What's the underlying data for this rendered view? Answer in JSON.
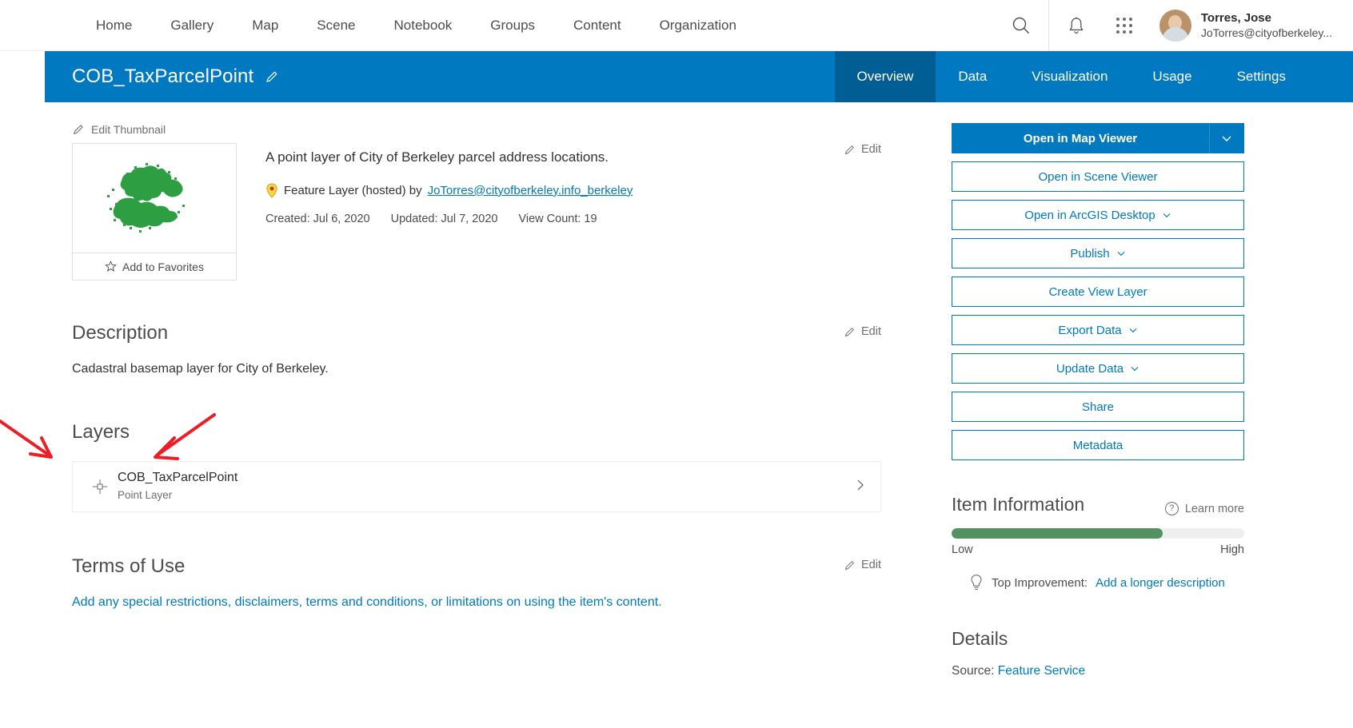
{
  "topnav": {
    "links": [
      {
        "label": "Home"
      },
      {
        "label": "Gallery"
      },
      {
        "label": "Map"
      },
      {
        "label": "Scene"
      },
      {
        "label": "Notebook"
      },
      {
        "label": "Groups"
      },
      {
        "label": "Content"
      },
      {
        "label": "Organization"
      }
    ],
    "search_icon": "search-icon",
    "notification_icon": "bell-icon",
    "apps_icon": "app-grid-icon",
    "user": {
      "name": "Torres, Jose",
      "email": "JoTorres@cityofberkeley..."
    }
  },
  "item_header": {
    "title": "COB_TaxParcelPoint",
    "edit_title_icon": "pencil-icon",
    "tabs": [
      {
        "label": "Overview",
        "active": true
      },
      {
        "label": "Data",
        "active": false
      },
      {
        "label": "Visualization",
        "active": false
      },
      {
        "label": "Usage",
        "active": false
      },
      {
        "label": "Settings",
        "active": false
      }
    ]
  },
  "overview": {
    "edit_thumbnail_label": "Edit Thumbnail",
    "add_to_favorites_label": "Add to Favorites",
    "summary": "A point layer of City of Berkeley parcel address locations.",
    "item_type": "Feature Layer (hosted) by",
    "owner": "JoTorres@cityofberkeley.info_berkeley",
    "created_label": "Created: Jul 6, 2020",
    "updated_label": "Updated: Jul 7, 2020",
    "view_count_label": "View Count: 19",
    "edit_label": "Edit",
    "description": {
      "heading": "Description",
      "body": "Cadastral basemap layer for City of Berkeley.",
      "edit_label": "Edit"
    },
    "layers": {
      "heading": "Layers",
      "items": [
        {
          "name": "COB_TaxParcelPoint",
          "type": "Point Layer"
        }
      ]
    },
    "terms_of_use": {
      "heading": "Terms of Use",
      "placeholder_link": "Add any special restrictions, disclaimers, terms and conditions, or limitations on using the item's content.",
      "edit_label": "Edit"
    }
  },
  "sidebar": {
    "primary_button": {
      "label": "Open in Map Viewer",
      "has_dropdown": true
    },
    "buttons": [
      {
        "label": "Open in Scene Viewer",
        "caret": false
      },
      {
        "label": "Open in ArcGIS Desktop",
        "caret": true
      },
      {
        "label": "Publish",
        "caret": true
      },
      {
        "label": "Create View Layer",
        "caret": false
      },
      {
        "label": "Export Data",
        "caret": true
      },
      {
        "label": "Update Data",
        "caret": true
      },
      {
        "label": "Share",
        "caret": false
      },
      {
        "label": "Metadata",
        "caret": false
      }
    ],
    "item_information": {
      "heading": "Item Information",
      "learn_more": "Learn more",
      "meter_percent": 72,
      "meter_color": "#539160",
      "low_label": "Low",
      "high_label": "High",
      "top_improvement_label": "Top Improvement:",
      "top_improvement_link": "Add a longer description"
    },
    "details": {
      "heading": "Details",
      "source_label": "Source:",
      "source_value": "Feature Service"
    }
  },
  "colors": {
    "brand_blue": "#0079c1",
    "active_tab_blue": "#005e95",
    "link_blue": "#0079c1",
    "annotation_red": "#ee1c25"
  }
}
